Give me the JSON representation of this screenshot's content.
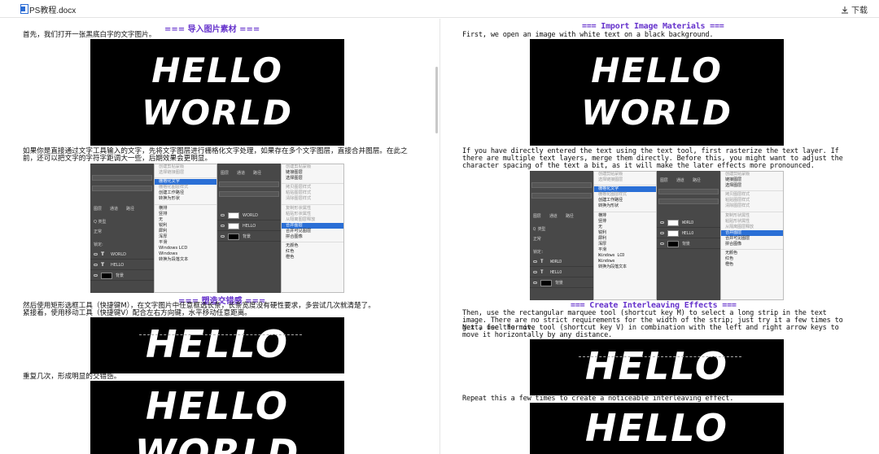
{
  "topbar": {
    "file_name": "PS教程.docx",
    "download_label": "下载"
  },
  "left": {
    "heading1": "=== 导入图片素材 ===",
    "p1": "首先，我们打开一张黑底白字的文字图片。",
    "p2": "如果你是直接通过文字工具输入的文字，先将文字图层进行栅格化文字处理，如果存在多个文字图层，直接合并图层。在此之前，还可以把文字的字符字距调大一些，后期效果会更明显。",
    "heading2": "=== 塑造交错感 ===",
    "p3": "然后使用矩形选框工具（快捷键M），在文字图片中任意框选长条，长条宽度没有硬性要求，多尝试几次就清楚了。",
    "p4": "紧接着，使用移动工具（快捷键V）配合左右方向键，水平移动任意距离。",
    "p5": "重复几次，形成明显的交错感。"
  },
  "right": {
    "heading1": "=== Import Image Materials ===",
    "p1": "First, we open an image with white text on a black background.",
    "p2": "If you have directly entered the text using the text tool, first rasterize the text layer. If there are multiple text layers, merge them directly. Before this, you might want to adjust the character spacing of the text a bit, as it will make the later effects more pronounced.",
    "heading2": "=== Create Interleaving Effects ===",
    "p3": "Then, use the rectangular marquee tool (shortcut key M) to select a long strip in the text image. There are no strict requirements for the width of the strip; just try it a few times to get a feel for it.",
    "p4": "Next, use the move tool (shortcut key V) in combination with the left and right arrow keys to move it horizontally by any distance.",
    "p5": "Repeat this a few times to create a noticeable interleaving effect."
  },
  "hello_image": {
    "line1": "HELLO",
    "line2": "WORLD"
  },
  "ps_screenshot": {
    "tabs": [
      "图层",
      "通道",
      "路径"
    ],
    "kind": "Q 类型",
    "blend": "正常",
    "lock_label": "锁定:",
    "layers": [
      "WORLD",
      "HELLO",
      "背景"
    ],
    "menu1": [
      "创建剪贴蒙版",
      "选择链接图层",
      "栅格化文字",
      "栅格化图层样式",
      "创建工作路径",
      "转换为形状",
      "横排",
      "竖排",
      "无",
      "锐利",
      "犀利",
      "浑厚",
      "平滑",
      "Windows LCD",
      "Windows",
      "转换为段落文本"
    ],
    "menu2": [
      "创建剪贴蒙版",
      "链接图层",
      "选择图层",
      "拷贝图层样式",
      "粘贴图层样式",
      "清除图层样式",
      "复制形状属性",
      "粘贴形状属性",
      "从隔离图层释放",
      "合并图层",
      "合并可见图层",
      "拼合图像",
      "无颜色",
      "红色",
      "橙色"
    ]
  },
  "colors": {
    "heading_purple": "#6633cc",
    "menu_highlight": "#2a6fd6"
  }
}
